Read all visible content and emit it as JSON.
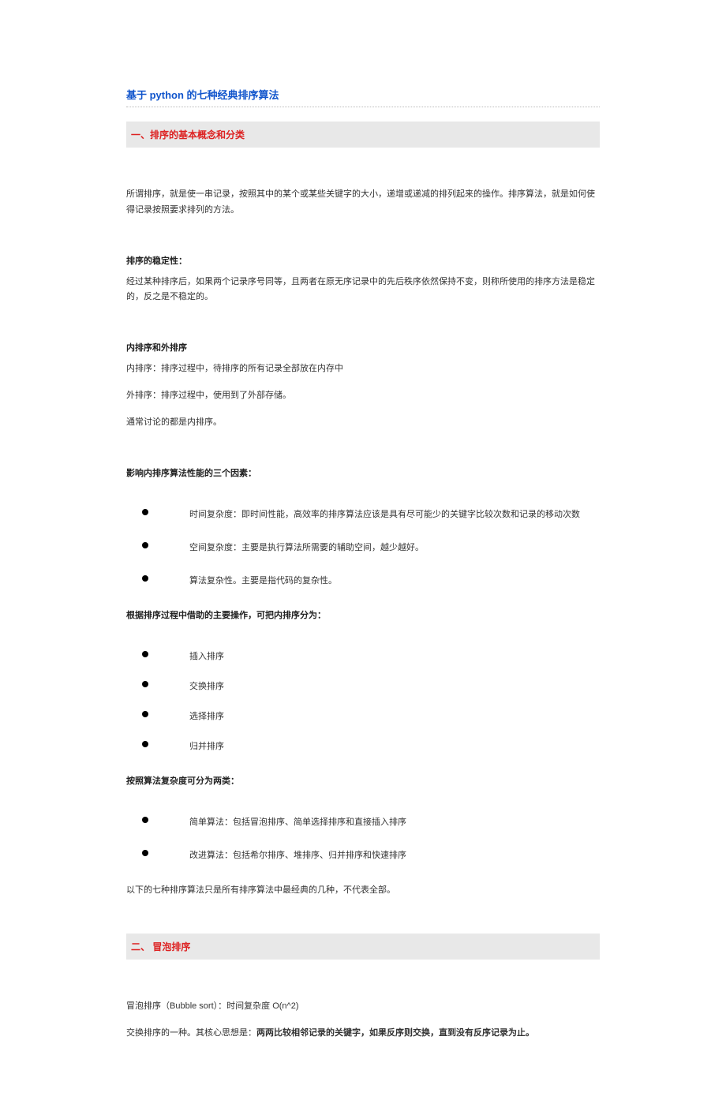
{
  "title": "基于 python 的七种经典排序算法",
  "section1": {
    "header": "一、排序的基本概念和分类",
    "intro": "所谓排序，就是使一串记录，按照其中的某个或某些关键字的大小，递增或递减的排列起来的操作。排序算法，就是如何使得记录按照要求排列的方法。",
    "stability_head": "排序的稳定性：",
    "stability_body": "经过某种排序后，如果两个记录序号同等，且两者在原无序记录中的先后秩序依然保持不变，则称所使用的排序方法是稳定的，反之是不稳定的。",
    "internal_head": "内排序和外排序",
    "internal_a": "内排序：排序过程中，待排序的所有记录全部放在内存中",
    "internal_b": "外排序：排序过程中，使用到了外部存储。",
    "internal_c": "通常讨论的都是内排序。",
    "factors_head": "影响内排序算法性能的三个因素：",
    "factors": [
      "时间复杂度：即时间性能，高效率的排序算法应该是具有尽可能少的关键字比较次数和记录的移动次数",
      "空间复杂度：主要是执行算法所需要的辅助空间，越少越好。",
      "算法复杂性。主要是指代码的复杂性。"
    ],
    "ops_head": "根据排序过程中借助的主要操作，可把内排序分为：",
    "ops": [
      "插入排序",
      "交换排序",
      "选择排序",
      "归并排序"
    ],
    "complexity_head": "按照算法复杂度可分为两类：",
    "complexity": [
      "简单算法：包括冒泡排序、简单选择排序和直接插入排序",
      "改进算法：包括希尔排序、堆排序、归并排序和快速排序"
    ],
    "note": "以下的七种排序算法只是所有排序算法中最经典的几种，不代表全部。"
  },
  "section2": {
    "header": "二、 冒泡排序",
    "line1": "冒泡排序（Bubble sort）：时间复杂度 O(n^2)",
    "line2_a": "交换排序的一种。其核心思想是：",
    "line2_b": "两两比较相邻记录的关键字，如果反序则交换，直到没有反序记录为止。"
  }
}
